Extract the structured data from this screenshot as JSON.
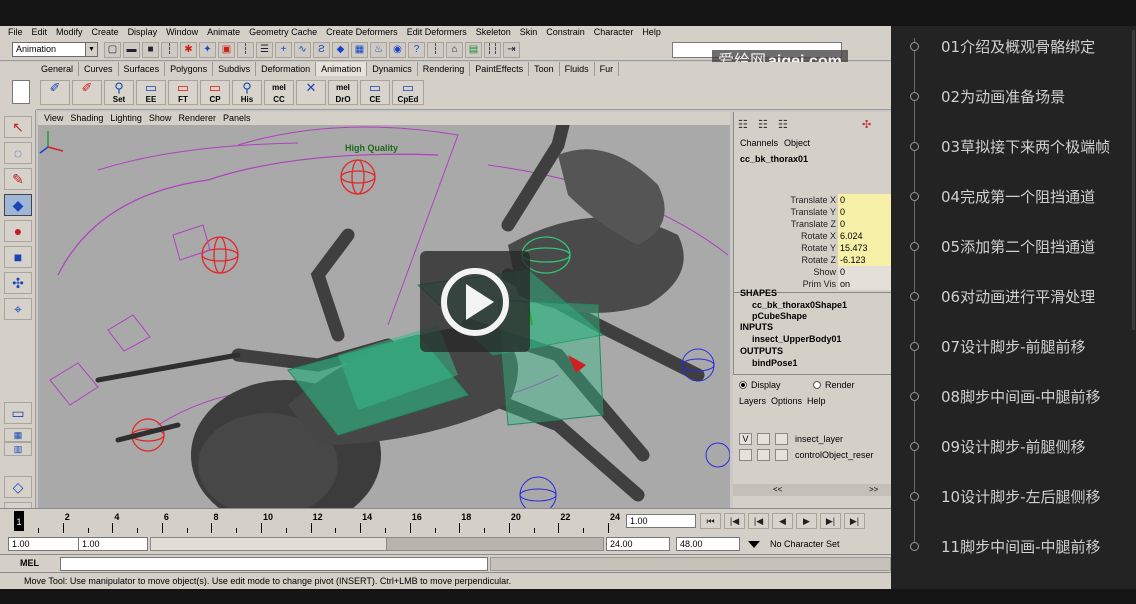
{
  "menubar": [
    "File",
    "Edit",
    "Modify",
    "Create",
    "Display",
    "Window",
    "Animate",
    "Geometry Cache",
    "Create Deformers",
    "Edit Deformers",
    "Skeleton",
    "Skin",
    "Constrain",
    "Character",
    "Help"
  ],
  "status_line": {
    "mode": "Animation"
  },
  "watermark": {
    "cn": "爱给网",
    "en": "aigei.com"
  },
  "shelf_tabs": [
    "General",
    "Curves",
    "Surfaces",
    "Polygons",
    "Subdivs",
    "Deformation",
    "Animation",
    "Dynamics",
    "Rendering",
    "PaintEffects",
    "Toon",
    "Fluids",
    "Fur"
  ],
  "shelf_tools": [
    {
      "label": "",
      "icon": "joint-icon"
    },
    {
      "label": "",
      "icon": "ik-handle-icon"
    },
    {
      "label": "Set",
      "icon": "set-icon"
    },
    {
      "label": "EE",
      "icon": "ee-icon"
    },
    {
      "label": "FT",
      "icon": "ft-icon"
    },
    {
      "label": "CP",
      "icon": "cp-icon"
    },
    {
      "label": "His",
      "icon": "history-icon"
    },
    {
      "label": "CC",
      "icon": "mel-icon"
    },
    {
      "label": "",
      "icon": "bind-icon"
    },
    {
      "label": "DrO",
      "icon": "mel-icon"
    },
    {
      "label": "CE",
      "icon": "ce-icon"
    },
    {
      "label": "CpEd",
      "icon": "cped-icon"
    }
  ],
  "shelf_mel_tag": "mel",
  "panel_menu": [
    "View",
    "Shading",
    "Lighting",
    "Show",
    "Renderer",
    "Panels"
  ],
  "viewport": {
    "hq_label": "High Quality"
  },
  "channel_box": {
    "menu": [
      "Channels",
      "Object"
    ],
    "node": "cc_bk_thorax01",
    "attrs": [
      {
        "name": "Translate X",
        "value": "0"
      },
      {
        "name": "Translate Y",
        "value": "0"
      },
      {
        "name": "Translate Z",
        "value": "0"
      },
      {
        "name": "Rotate X",
        "value": "6.024"
      },
      {
        "name": "Rotate Y",
        "value": "15.473"
      },
      {
        "name": "Rotate Z",
        "value": "-6.123"
      },
      {
        "name": "Show",
        "value": "0"
      },
      {
        "name": "Prim Vis",
        "value": "on"
      }
    ],
    "shapes_head": "SHAPES",
    "shapes": [
      "cc_bk_thorax0Shape1",
      "pCubeShape"
    ],
    "inputs_head": "INPUTS",
    "inputs": [
      "insect_UpperBody01"
    ],
    "outputs_head": "OUTPUTS",
    "outputs": [
      "bindPose1"
    ]
  },
  "layer_editor": {
    "display": "Display",
    "render": "Render",
    "menu": [
      "Layers",
      "Options",
      "Help"
    ],
    "layers": [
      {
        "v": "V",
        "name": "insect_layer"
      },
      {
        "v": "",
        "name": "controlObject_reser"
      }
    ],
    "scroll_left": "<<",
    "scroll_right": ">>"
  },
  "timeslider": {
    "current": "1",
    "ticks": [
      "2",
      "4",
      "6",
      "8",
      "10",
      "12",
      "14",
      "16",
      "18",
      "20",
      "22",
      "24"
    ],
    "current_field": "1.00"
  },
  "playback": [
    "⏮",
    "|◀",
    "|◀",
    "◀",
    "▶",
    "▶|",
    "▶|"
  ],
  "range": {
    "start": "1.00",
    "start2": "1.00",
    "end": "24.00",
    "end2": "48.00",
    "character_set": "No Character Set"
  },
  "cmdline": {
    "label": "MEL"
  },
  "helpline": "Move Tool: Use manipulator to move object(s). Use edit mode to change pivot (INSERT). Ctrl+LMB to move perpendicular.",
  "playlist": [
    "01介绍及概观骨骼绑定",
    "02为动画准备场景",
    "03草拟接下来两个极端帧",
    "04完成第一个阻挡通道",
    "05添加第二个阻挡通道",
    "06对动画进行平滑处理",
    "07设计脚步-前腿前移",
    "08脚步中间画-中腿前移",
    "09设计脚步-前腿侧移",
    "10设计脚步-左后腿侧移",
    "11脚步中间画-中腿前移"
  ]
}
